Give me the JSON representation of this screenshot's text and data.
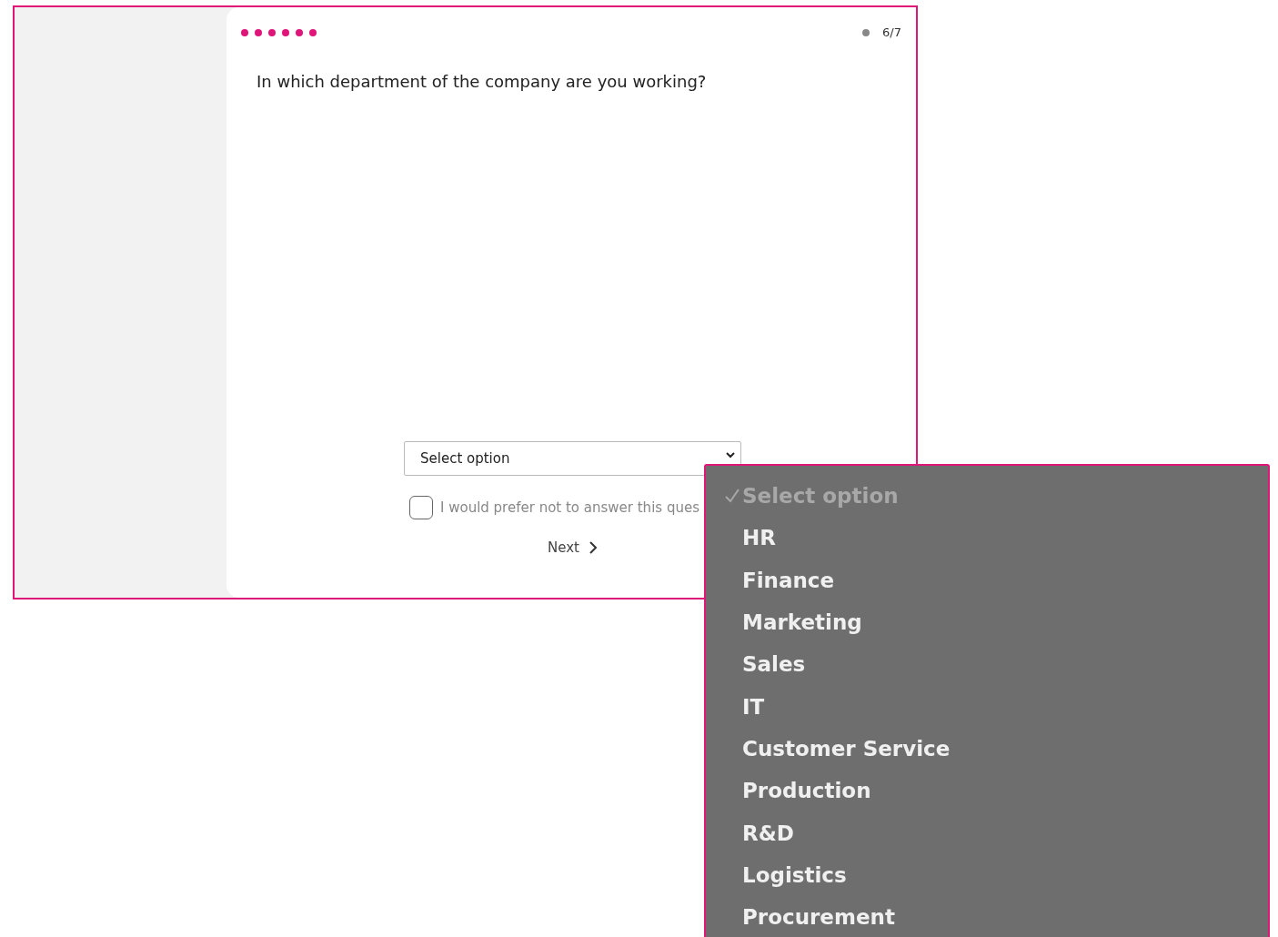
{
  "progress": {
    "steps": [
      {
        "done": true
      },
      {
        "done": true
      },
      {
        "done": true
      },
      {
        "done": true
      },
      {
        "done": true
      },
      {
        "done": true
      },
      {
        "done": false
      }
    ],
    "counter": "6/7"
  },
  "question": "In which department of the company are you working?",
  "select": {
    "value": "Select option"
  },
  "opt_out": {
    "label": "I would prefer not to answer this ques",
    "checked": false
  },
  "next": {
    "label": "Next"
  },
  "dropdown": {
    "options": [
      {
        "label": "Select option",
        "selected": true,
        "disabled": true
      },
      {
        "label": "HR",
        "selected": false,
        "disabled": false
      },
      {
        "label": "Finance",
        "selected": false,
        "disabled": false
      },
      {
        "label": "Marketing",
        "selected": false,
        "disabled": false
      },
      {
        "label": "Sales",
        "selected": false,
        "disabled": false
      },
      {
        "label": "IT",
        "selected": false,
        "disabled": false
      },
      {
        "label": "Customer Service",
        "selected": false,
        "disabled": false
      },
      {
        "label": "Production",
        "selected": false,
        "disabled": false
      },
      {
        "label": "R&D",
        "selected": false,
        "disabled": false
      },
      {
        "label": "Logistics",
        "selected": false,
        "disabled": false
      },
      {
        "label": "Procurement",
        "selected": false,
        "disabled": false
      }
    ]
  }
}
